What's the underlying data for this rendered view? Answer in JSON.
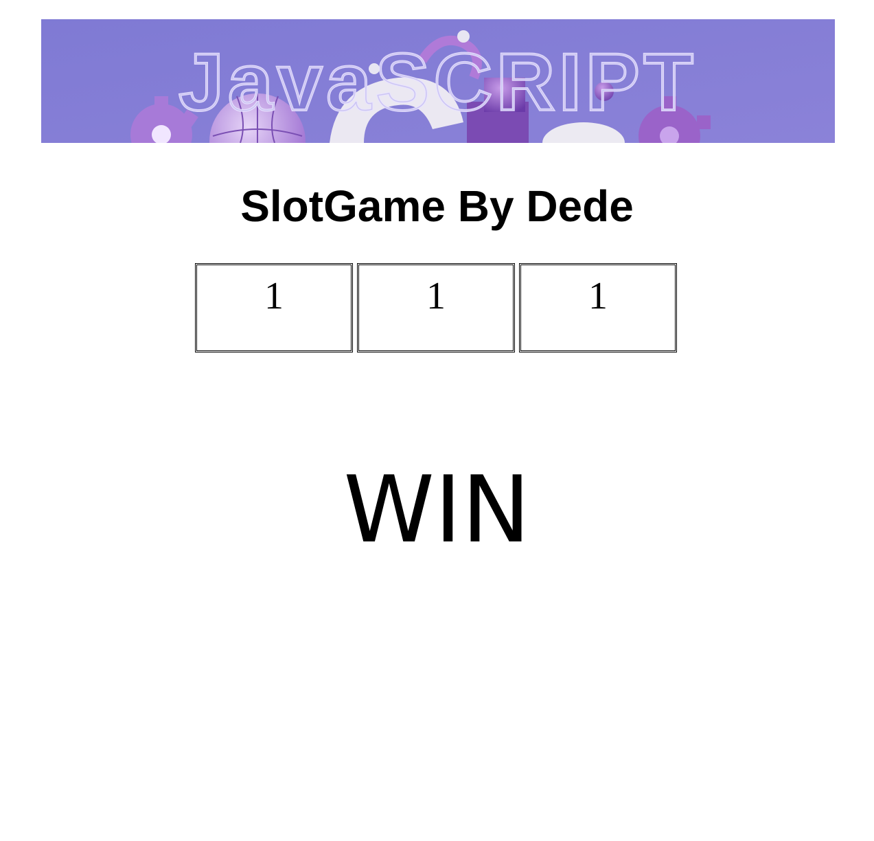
{
  "banner": {
    "logo_text": "JavaSCRIPT",
    "background_color": "#8a80d6",
    "icon": "javascript-banner-image"
  },
  "title": "SlotGame By Dede",
  "slots": [
    "1",
    "1",
    "1"
  ],
  "result": "WIN"
}
